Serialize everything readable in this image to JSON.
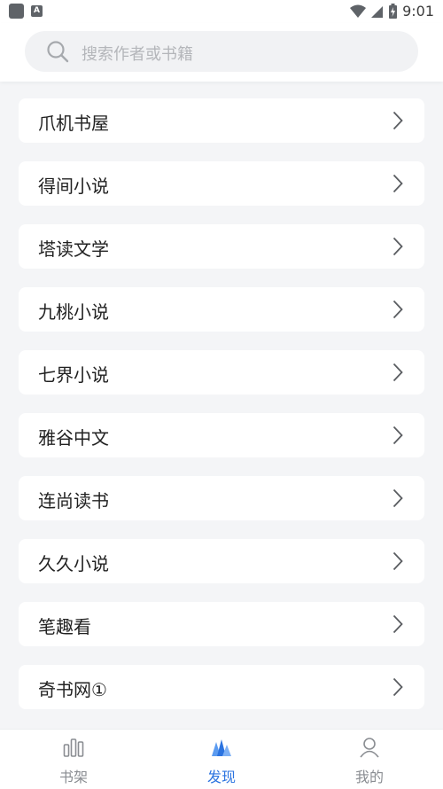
{
  "status_bar": {
    "time": "9:01",
    "icons": [
      "app-square-icon",
      "a-notification-icon",
      "wifi-icon",
      "signal-icon",
      "battery-icon"
    ]
  },
  "search": {
    "placeholder": "搜索作者或书籍",
    "icon": "search-icon"
  },
  "sources": [
    {
      "label": " 爪机书屋"
    },
    {
      "label": " 得间小说"
    },
    {
      "label": " 塔读文学"
    },
    {
      "label": " 九桃小说"
    },
    {
      "label": " 七界小说"
    },
    {
      "label": " 雅谷中文"
    },
    {
      "label": " 连尚读书"
    },
    {
      "label": " 久久小说"
    },
    {
      "label": " 笔趣看"
    },
    {
      "label": " 奇书网①"
    }
  ],
  "tabs": [
    {
      "label": "书架",
      "icon": "bookshelf-icon",
      "active": false
    },
    {
      "label": "发现",
      "icon": "discover-icon",
      "active": true
    },
    {
      "label": "我的",
      "icon": "profile-icon",
      "active": false
    }
  ],
  "colors": {
    "accent": "#2b73e0",
    "background": "#f4f5f7",
    "card": "#ffffff",
    "inactive_tab": "#8a8d92"
  }
}
